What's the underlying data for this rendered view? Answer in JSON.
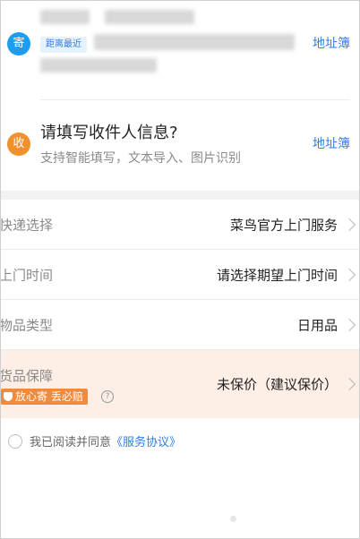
{
  "sender": {
    "badge": "寄",
    "distance_tag": "距离最近",
    "address_book": "地址簿"
  },
  "receiver": {
    "badge": "收",
    "title": "请填写收件人信息?",
    "subtitle": "支持智能填写，文本导入、图片识别",
    "address_book": "地址簿"
  },
  "rows": [
    {
      "label": "快递选择",
      "value": "菜鸟官方上门服务"
    },
    {
      "label": "上门时间",
      "value": "请选择期望上门时间"
    },
    {
      "label": "物品类型",
      "value": "日用品"
    }
  ],
  "insurance": {
    "label": "货品保障",
    "badge": "放心寄 丢必赔",
    "help": "?",
    "value": "未保价（建议保价）"
  },
  "agreement": {
    "text": "我已阅读并同意",
    "link": "《服务协议》"
  }
}
